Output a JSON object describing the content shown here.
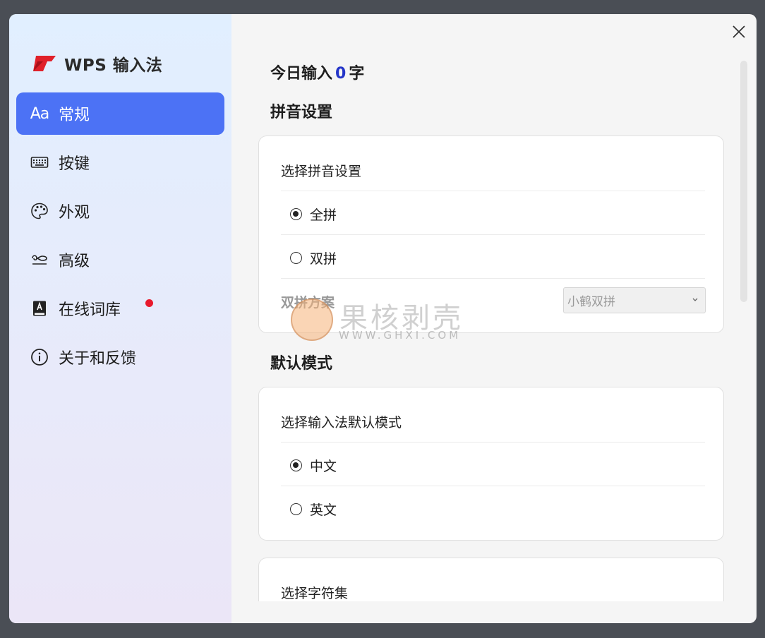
{
  "app": {
    "title": "WPS 输入法"
  },
  "sidebar": {
    "items": [
      {
        "icon": "font-aa-icon",
        "label": "常规",
        "active": true,
        "glyph": "Aa"
      },
      {
        "icon": "keyboard-icon",
        "label": "按键",
        "active": false
      },
      {
        "icon": "palette-icon",
        "label": "外观",
        "active": false
      },
      {
        "icon": "advanced-icon",
        "label": "高级",
        "active": false
      },
      {
        "icon": "dictionary-icon",
        "label": "在线词库",
        "active": false,
        "badge": "red-dot"
      },
      {
        "icon": "info-icon",
        "label": "关于和反馈",
        "active": false
      }
    ]
  },
  "main": {
    "today": {
      "prefix": "今日输入",
      "count": "0",
      "suffix": "字"
    },
    "pinyin_section": {
      "title": "拼音设置",
      "card_title": "选择拼音设置",
      "options": [
        {
          "label": "全拼",
          "checked": true
        },
        {
          "label": "双拼",
          "checked": false
        }
      ],
      "scheme_label": "双拼方案",
      "scheme_value": "小鹤双拼"
    },
    "mode_section": {
      "title": "默认模式",
      "card_title": "选择输入法默认模式",
      "options": [
        {
          "label": "中文",
          "checked": true
        },
        {
          "label": "英文",
          "checked": false
        }
      ]
    },
    "charset_section": {
      "card_title": "选择字符集"
    }
  },
  "watermark": {
    "text": "果核剥壳",
    "url": "WWW.GHXI.COM"
  },
  "colors": {
    "accent": "#4c72f5",
    "count": "#2435c8",
    "badge": "#e8192c"
  }
}
